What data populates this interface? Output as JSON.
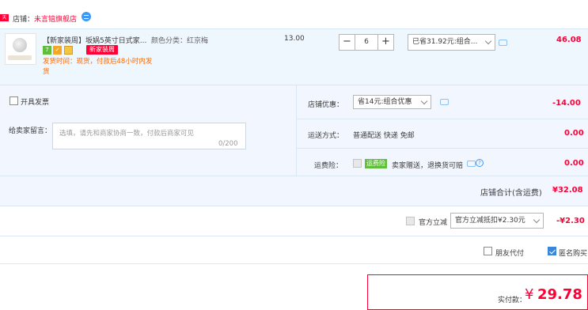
{
  "shop": {
    "badge": "天猫",
    "prefix": "店铺：",
    "name": "未言锫旗舰店"
  },
  "item": {
    "title": "【新家装周】坂娲5英寸日式家...",
    "sku": "颜色分类：红京梅",
    "new_badge": "新家装周",
    "ship_note": "发货时间：现货，付款后48小时内发货",
    "unit_price": "13.00",
    "quantity": "6",
    "minus": "−",
    "plus": "+",
    "promo": "已省31.92元:组合...",
    "total": "46.08",
    "icons": [
      "tmall-7day-icon",
      "guarantee-icon",
      "card-icon"
    ]
  },
  "options": {
    "invoice_label": "开具发票",
    "message_label": "给卖家留言：",
    "message_placeholder": "选填，请先和商家协商一致，付款后商家可见",
    "message_count": "0/200",
    "shop_discount_label": "店铺优惠：",
    "shop_discount_select": "省14元:组合优惠",
    "shop_discount_value": "-14.00",
    "delivery_label": "运送方式：",
    "delivery_method": "普通配送 快递 免邮",
    "delivery_value": "0.00",
    "insurance_label": "运费险：",
    "insurance_tag": "运费险",
    "insurance_text": "卖家赠送，退换货可赔",
    "insurance_value": "0.00"
  },
  "summary": {
    "label": "店铺合计(含运费)",
    "value": "¥32.08"
  },
  "official": {
    "label": "官方立减",
    "select": "官方立减抵扣¥2.30元",
    "value": "-¥2.30"
  },
  "extras": {
    "friend_pay": "朋友代付",
    "anonymous": "匿名购买"
  },
  "payment": {
    "label": "实付款：",
    "currency": "¥",
    "amount": "29.78"
  },
  "colors": {
    "accent_red": "#ff0036",
    "highlight_blue": "#eef6fe",
    "checkbox_blue": "#3a86d8"
  }
}
